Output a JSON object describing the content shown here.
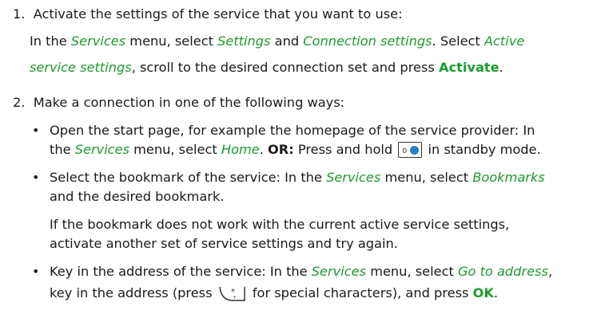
{
  "step1": {
    "number": "1.",
    "text": "Activate the settings of the service that you want to use:",
    "line1": {
      "a": "In the ",
      "services": "Services",
      "b": " menu, select ",
      "settings": "Settings",
      "c": " and ",
      "connection": "Connection settings",
      "d": ". Select ",
      "active": "Active"
    },
    "line2": {
      "active_cont": "service settings",
      "a": ", scroll to the desired connection set and press ",
      "activate": "Activate",
      "b": "."
    }
  },
  "step2": {
    "number": "2.",
    "text": "Make a connection in one of the following ways:",
    "bullet1": {
      "line1": "Open the start page, for example the homepage of the service provider: In",
      "line2": {
        "a": "the ",
        "services": "Services",
        "b": " menu, select ",
        "home": "Home",
        "c": ". ",
        "or": "OR:",
        "d": " Press and hold ",
        "e": " in standby mode."
      },
      "key_icon": "key-0-globe-icon"
    },
    "bullet2": {
      "line1": {
        "a": "Select the bookmark of the service: In the ",
        "services": "Services",
        "b": " menu, select ",
        "bookmarks": "Bookmarks"
      },
      "line2": "and the desired bookmark.",
      "note1": "If the bookmark does not work with the current active service settings,",
      "note2": "activate another set of service settings and try again."
    },
    "bullet3": {
      "line1": {
        "a": "Key in the address of the service: In the ",
        "services": "Services",
        "b": " menu, select ",
        "goto": "Go to address",
        "c": ","
      },
      "line2": {
        "a": "key in the address (press ",
        "b": " for special characters), and press ",
        "ok": "OK",
        "c": "."
      },
      "key_icon": "key-star-icon"
    },
    "bullet_char": "•"
  },
  "colors": {
    "accent_green": "#1e9a2f",
    "text": "#1a1a1a"
  }
}
